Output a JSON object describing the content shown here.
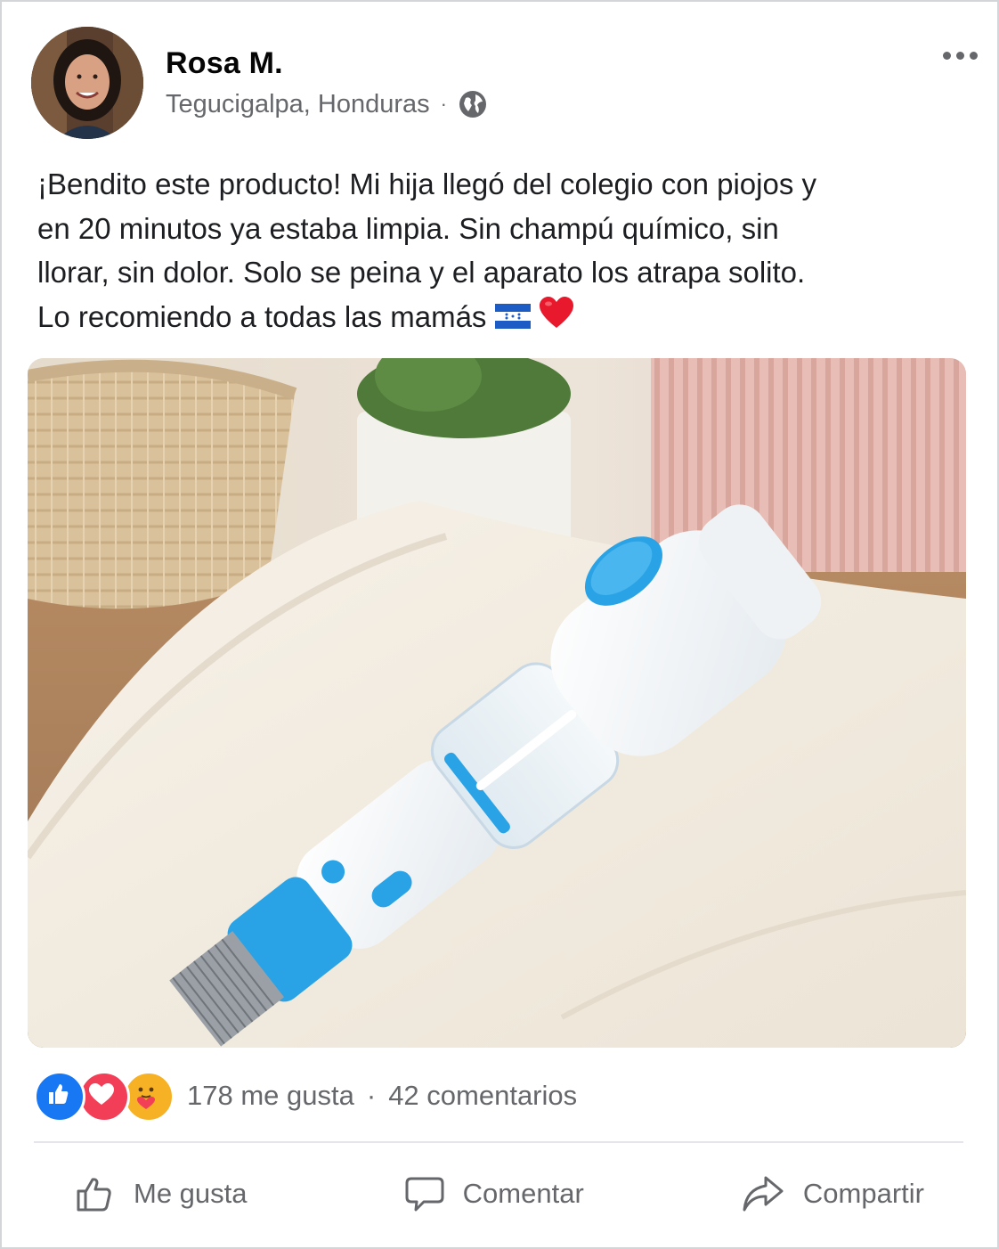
{
  "post": {
    "author": "Rosa M.",
    "location": "Tegucigalpa, Honduras",
    "separator": "·",
    "privacy_icon": "globe-icon",
    "text": "¡Bendito este producto! Mi hija llegó del colegio con piojos y\nen 20 minutos ya estaba limpia. Sin champú químico, sin\nllorar, sin dolor. Solo se peina y el aparato los atrapa solito.\nLo recomiendo a todas las mamás",
    "emojis": [
      "honduras-flag-emoji",
      "red-heart-emoji"
    ]
  },
  "engagement": {
    "reaction_icons": [
      "like-reaction-icon",
      "love-reaction-icon",
      "care-reaction-icon"
    ],
    "likes": "178 me gusta",
    "separator": "·",
    "comments": "42 comentarios"
  },
  "actions": {
    "like": "Me gusta",
    "comment": "Comentar",
    "share": "Compartir"
  },
  "colors": {
    "brand_blue": "#1877f2",
    "love_red": "#f33e58",
    "text_secondary": "#65676b",
    "device_blue": "#2aa3e6"
  }
}
